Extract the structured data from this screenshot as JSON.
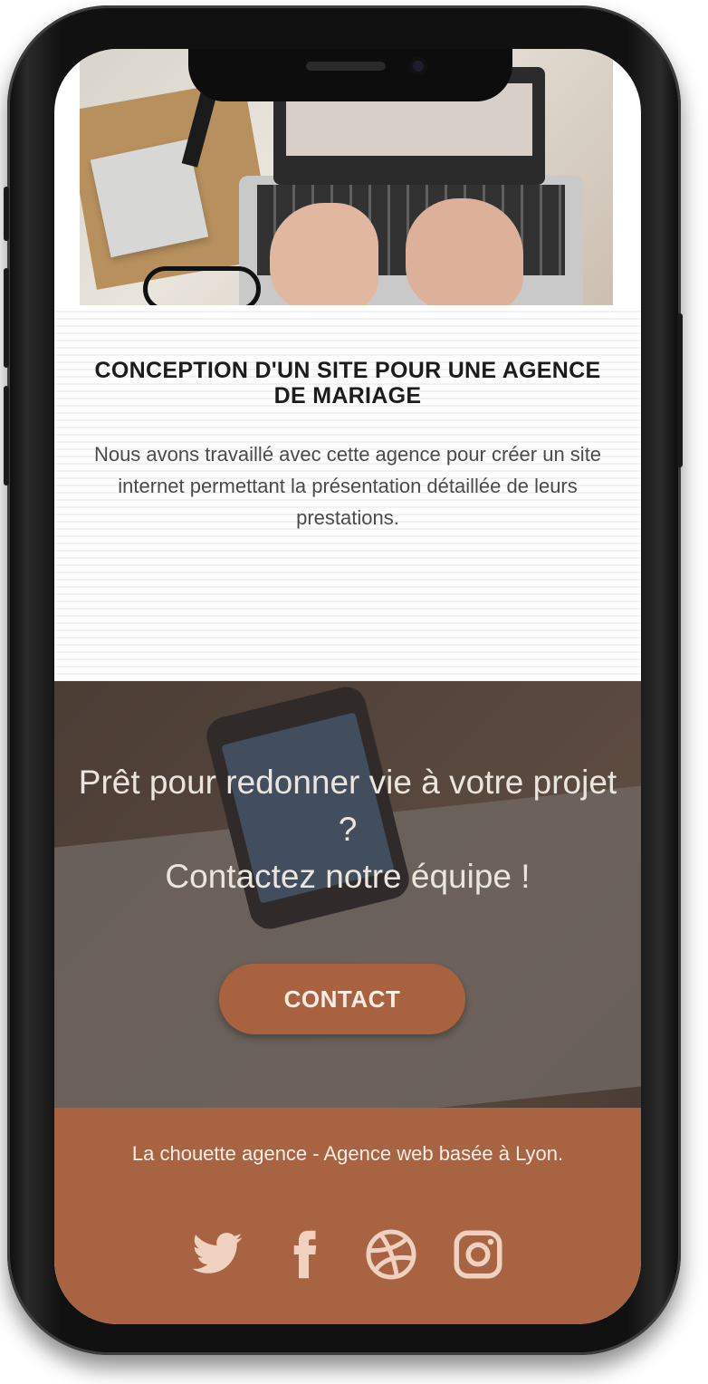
{
  "project": {
    "title": "CONCEPTION D'UN SITE POUR UNE AGENCE DE MARIAGE",
    "description": "Nous avons travaillé avec cette agence pour créer un site internet permettant la présentation détaillée de leurs prestations."
  },
  "cta": {
    "line1": "Prêt pour redonner vie à votre projet ?",
    "line2": "Contactez notre équipe !",
    "button_label": "CONTACT"
  },
  "footer": {
    "text": "La chouette agence - Agence web basée à Lyon.",
    "socials": [
      "twitter-icon",
      "facebook-icon",
      "dribbble-icon",
      "instagram-icon"
    ]
  },
  "colors": {
    "accent": "#a86343",
    "button": "#a9623f",
    "icon": "#f0d0bf"
  }
}
